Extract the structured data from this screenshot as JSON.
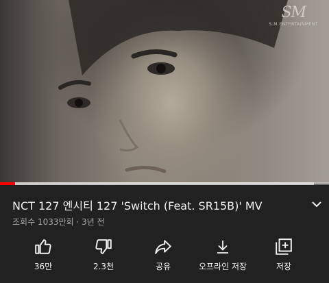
{
  "video": {
    "watermark_logo": "SM",
    "watermark_sub": "S.M.ENTERTAINMENT",
    "progress_played": 0.045,
    "progress_buffered": 0.955
  },
  "info": {
    "title": "NCT 127 엔시티 127 'Switch (Feat. SR15B)' MV",
    "meta": "조회수 1033만회 · 3년 전"
  },
  "actions": [
    {
      "label": "36만",
      "icon": "thumbs-up-icon"
    },
    {
      "label": "2.3천",
      "icon": "thumbs-down-icon"
    },
    {
      "label": "공유",
      "icon": "share-icon"
    },
    {
      "label": "오프라인 저장",
      "icon": "download-icon"
    },
    {
      "label": "저장",
      "icon": "add-to-playlist-icon"
    }
  ],
  "colors": {
    "background": "#212121",
    "progress": "#ff0000",
    "secondary_text": "#aaaaaa"
  }
}
